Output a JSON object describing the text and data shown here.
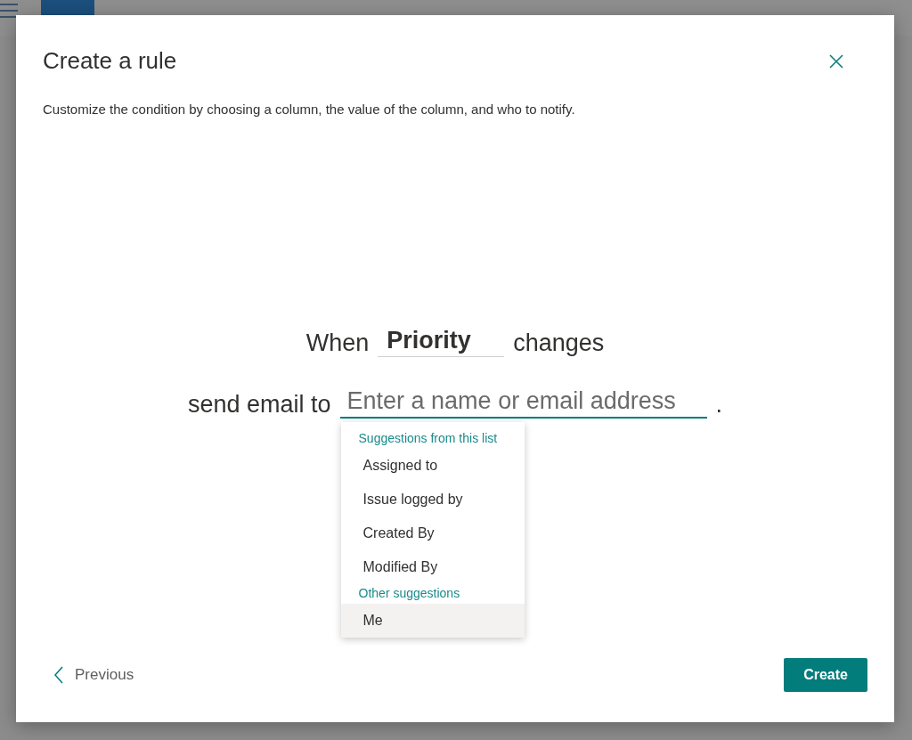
{
  "dialog": {
    "title": "Create a rule",
    "description": "Customize the condition by choosing a column, the value of the column, and who to notify.",
    "condition": {
      "prefix": "When",
      "column": "Priority",
      "suffix": "changes"
    },
    "notify": {
      "prefix": "send email to",
      "placeholder": "Enter a name or email address",
      "suffix": "."
    },
    "suggestions": [
      {
        "header": "Suggestions from this list",
        "items": [
          {
            "label": "Assigned to",
            "selected": false
          },
          {
            "label": "Issue logged by",
            "selected": false
          },
          {
            "label": "Created By",
            "selected": false
          },
          {
            "label": "Modified By",
            "selected": false
          }
        ]
      },
      {
        "header": "Other suggestions",
        "items": [
          {
            "label": "Me",
            "selected": true
          }
        ]
      }
    ],
    "previous": "Previous",
    "create": "Create"
  }
}
